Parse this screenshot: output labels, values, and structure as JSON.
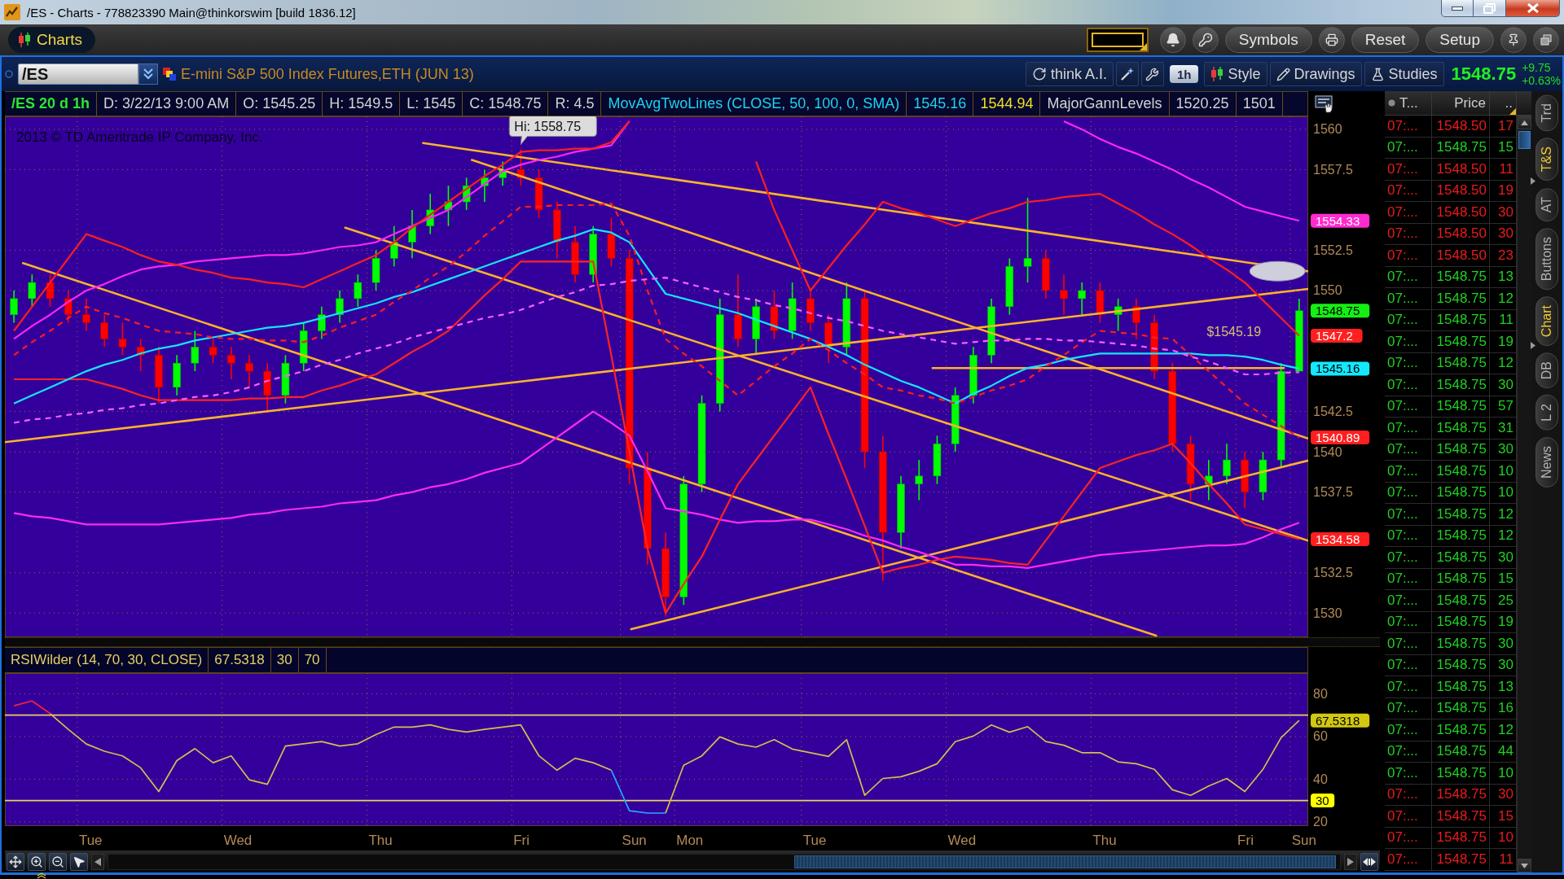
{
  "window": {
    "title": "/ES - Charts - 778823390 Main@thinkorswim [build 1836.12]"
  },
  "toolbar": {
    "tab": {
      "label": "Charts",
      "selected": true
    },
    "buttons": [
      "Symbols",
      "Reset",
      "Setup"
    ]
  },
  "header": {
    "symbol": "/ES",
    "description": "E-mini S&P 500 Index Futures,ETH (JUN 13)",
    "ai_button": "think A.I.",
    "aggregation": "1h",
    "style_button": "Style",
    "drawings_button": "Drawings",
    "studies_button": "Studies",
    "last_price": "1548.75",
    "change": "+9.75",
    "change_percent": "+0.63%"
  },
  "info_row": {
    "symbol": "/ES 20 d 1h",
    "cells": [
      {
        "text": "D: 3/22/13 9:00 AM",
        "color": "#d2d2d2"
      },
      {
        "text": "O: 1545.25",
        "color": "#d2d2d2"
      },
      {
        "text": "H: 1549.5",
        "color": "#d2d2d2"
      },
      {
        "text": "L: 1545",
        "color": "#d2d2d2"
      },
      {
        "text": "C: 1548.75",
        "color": "#d2d2d2"
      },
      {
        "text": "R: 4.5",
        "color": "#d2d2d2"
      },
      {
        "text": "MovAvgTwoLines (CLOSE, 50, 100, 0, SMA)",
        "color": "#1ed2f0"
      },
      {
        "text": "1545.16",
        "color": "#1ed2f0"
      },
      {
        "text": "1544.94",
        "color": "#f0e020"
      },
      {
        "text": "MajorGannLevels",
        "color": "#d2d2d2"
      },
      {
        "text": "1520.25",
        "color": "#d2d2d2"
      },
      {
        "text": "1501",
        "color": "#d2d2d2"
      }
    ]
  },
  "price_chart": {
    "copyright": "2013 © TD Ameritrade IP Company, Inc.",
    "level_label": "$1545.19",
    "axis_badges": [
      {
        "text": "1554.33",
        "color": "#ff2bd0"
      },
      {
        "text": "1548.75",
        "color": "#14f014"
      },
      {
        "text": "1547.2",
        "color": "#ff1f1f"
      },
      {
        "text": "1545.16",
        "color": "#14e8ff"
      },
      {
        "text": "1540.89",
        "color": "#ff1f1f"
      },
      {
        "text": "1534.58",
        "color": "#ff1f1f"
      }
    ],
    "chart_data": {
      "type": "candlestick",
      "grid": true,
      "ylim": [
        1528.5,
        1560.8
      ],
      "yticks": [
        1530,
        1537.5,
        1542.5,
        1552.5,
        1560
      ],
      "categories": [
        null,
        null,
        null,
        null,
        null,
        null,
        null,
        null,
        null,
        null,
        null,
        null,
        null,
        null,
        null,
        null,
        null,
        null,
        null,
        null,
        null,
        null,
        null,
        null,
        null,
        null,
        null,
        null,
        null,
        null,
        null,
        null,
        null,
        null,
        null,
        null,
        null,
        null,
        null,
        null,
        null,
        null,
        null,
        null,
        null,
        null,
        null,
        null,
        null,
        null,
        null,
        null,
        null,
        null,
        null,
        null,
        null,
        null,
        null,
        null,
        null,
        null,
        null,
        null,
        null,
        null,
        null,
        null,
        null,
        null,
        null,
        null
      ],
      "ohlc": [
        [
          1548.5,
          1550,
          1548,
          1549.5
        ],
        [
          1549.5,
          1551,
          1549,
          1550.5
        ],
        [
          1550.5,
          1551,
          1549,
          1549.5
        ],
        [
          1549.5,
          1550,
          1548,
          1548.5
        ],
        [
          1548.5,
          1549.5,
          1547.5,
          1548
        ],
        [
          1548,
          1548.5,
          1546.5,
          1547
        ],
        [
          1547,
          1548,
          1546,
          1546.5
        ],
        [
          1546.5,
          1547,
          1545,
          1546
        ],
        [
          1546,
          1546.5,
          1543,
          1544
        ],
        [
          1544,
          1546,
          1543.5,
          1545.5
        ],
        [
          1545.5,
          1547.5,
          1545,
          1546.5
        ],
        [
          1546.5,
          1547,
          1545.5,
          1546
        ],
        [
          1546,
          1546.5,
          1544.5,
          1545.5
        ],
        [
          1545.5,
          1546,
          1544,
          1545
        ],
        [
          1545,
          1545.5,
          1542.5,
          1543.5
        ],
        [
          1543.5,
          1546,
          1543,
          1545.5
        ],
        [
          1545.5,
          1548,
          1545,
          1547.5
        ],
        [
          1547.5,
          1549,
          1547,
          1548.5
        ],
        [
          1548.5,
          1550,
          1548,
          1549.5
        ],
        [
          1549.5,
          1551,
          1549,
          1550.5
        ],
        [
          1550.5,
          1552.5,
          1550,
          1552
        ],
        [
          1552,
          1554,
          1551.5,
          1553
        ],
        [
          1553,
          1555,
          1552,
          1554
        ],
        [
          1554,
          1556,
          1553.5,
          1555
        ],
        [
          1555,
          1556.5,
          1554,
          1555.5
        ],
        [
          1555.5,
          1557,
          1555,
          1556.5
        ],
        [
          1556.5,
          1557.5,
          1555.5,
          1557
        ],
        [
          1557,
          1558,
          1556.5,
          1557.5
        ],
        [
          1557.5,
          1558.75,
          1556.5,
          1557
        ],
        [
          1557,
          1557.5,
          1554.5,
          1555
        ],
        [
          1555,
          1555.5,
          1552,
          1553
        ],
        [
          1553,
          1554,
          1550.5,
          1551
        ],
        [
          1551,
          1554,
          1550.5,
          1553.5
        ],
        [
          1553.5,
          1554.5,
          1551.5,
          1552
        ],
        [
          1552,
          1552.5,
          1538,
          1539
        ],
        [
          1539,
          1540,
          1533,
          1534
        ],
        [
          1534,
          1535,
          1529.8,
          1531
        ],
        [
          1531,
          1538.5,
          1530.5,
          1538
        ],
        [
          1538,
          1543.5,
          1537.5,
          1543
        ],
        [
          1543,
          1549.5,
          1542.5,
          1548.5
        ],
        [
          1548.5,
          1551,
          1546.5,
          1547
        ],
        [
          1547,
          1549.5,
          1546,
          1549
        ],
        [
          1549,
          1550,
          1547,
          1547.5
        ],
        [
          1547.5,
          1550.5,
          1547,
          1549.5
        ],
        [
          1549.5,
          1550,
          1547.5,
          1548
        ],
        [
          1548,
          1548.5,
          1545.5,
          1546.5
        ],
        [
          1546.5,
          1550.5,
          1546,
          1549.5
        ],
        [
          1549.5,
          1550,
          1539,
          1540
        ],
        [
          1540,
          1541,
          1532,
          1535
        ],
        [
          1535,
          1538.5,
          1534,
          1538
        ],
        [
          1538,
          1539.5,
          1537,
          1538.5
        ],
        [
          1538.5,
          1541,
          1538,
          1540.5
        ],
        [
          1540.5,
          1544,
          1540,
          1543.5
        ],
        [
          1543.5,
          1546.5,
          1543,
          1546
        ],
        [
          1546,
          1549.5,
          1545.5,
          1549
        ],
        [
          1549,
          1552,
          1548.5,
          1551.5
        ],
        [
          1551.5,
          1555.75,
          1550.5,
          1552
        ],
        [
          1552,
          1552.5,
          1549.5,
          1550
        ],
        [
          1550,
          1551,
          1548.5,
          1549.5
        ],
        [
          1549.5,
          1550.5,
          1548.5,
          1550
        ],
        [
          1550,
          1550.5,
          1548,
          1548.5
        ],
        [
          1548.5,
          1549.5,
          1547.5,
          1549
        ],
        [
          1549,
          1549.5,
          1547,
          1548
        ],
        [
          1548,
          1548.5,
          1544.5,
          1545
        ],
        [
          1545,
          1545.5,
          1540,
          1540.5
        ],
        [
          1540.5,
          1541,
          1537,
          1538
        ],
        [
          1538,
          1539.5,
          1537,
          1538.5
        ],
        [
          1538.5,
          1540.5,
          1538,
          1539.5
        ],
        [
          1539.5,
          1540,
          1536.5,
          1537.5
        ],
        [
          1537.5,
          1540,
          1537,
          1539.5
        ],
        [
          1539.5,
          1545.5,
          1539,
          1545
        ],
        [
          1545,
          1549.5,
          1545,
          1548.75
        ]
      ],
      "annotations": [
        "Hi: 1558.75"
      ]
    },
    "studies": {
      "chart_data": {
        "type": "line",
        "grid": true,
        "ylim": [
          1528.5,
          1560.8
        ],
        "yticks": [
          1532.5,
          1540,
          1550,
          1557.5
        ],
        "categories": [
          null,
          null,
          null,
          null,
          null,
          null,
          null,
          null,
          null,
          null,
          null,
          null,
          null,
          null,
          null,
          null,
          null,
          null,
          null,
          null,
          null,
          null,
          null,
          null,
          null,
          null,
          null,
          null,
          null,
          null,
          null,
          null,
          null,
          null,
          null,
          null,
          null,
          null,
          null,
          null,
          null,
          null,
          null,
          null,
          null,
          null,
          null,
          null,
          null,
          null,
          null,
          null,
          null,
          null,
          null,
          null,
          null,
          null,
          null,
          null,
          null,
          null,
          null,
          null,
          null,
          null,
          null,
          null,
          null,
          null,
          null,
          null
        ],
        "series": [
          {
            "color": "#ff26f0",
            "values": [
              1547,
              1547.8,
              1548.5,
              1549.3,
              1550,
              1550.4,
              1550.9,
              1551.3,
              1551.5,
              1551.6,
              1551.8,
              1551.9,
              1552,
              1552.1,
              1552.2,
              1552.2,
              1552.3,
              1552.5,
              1552.7,
              1552.8,
              1553,
              1553.5,
              1554,
              1554.5,
              1555,
              1555.8,
              1556.6,
              1557.4,
              1557.8,
              1558.1,
              1558.3,
              1558.6,
              1558.8,
              1559,
              1560.5,
              null,
              null,
              null,
              null,
              null,
              null,
              null,
              null,
              null,
              null,
              null,
              null,
              null,
              null,
              null,
              null,
              null,
              null,
              null,
              null,
              null,
              null,
              null,
              1560.5,
              1560,
              1559.4,
              1558.9,
              1558.5,
              1558,
              1557.5,
              1556.9,
              1556.4,
              1555.8,
              1555.2,
              1554.9,
              1554.6,
              1554.33
            ]
          },
          {
            "color": "#ff2aee",
            "values": [
              1536.2,
              1536,
              1535.9,
              1535.7,
              1535.5,
              1535.5,
              1535.5,
              1535.5,
              1535.5,
              1535.6,
              1535.7,
              1535.8,
              1535.9,
              1536.1,
              1536.2,
              1536.4,
              1536.5,
              1536.6,
              1536.8,
              1536.9,
              1537,
              1537.3,
              1537.5,
              1537.8,
              1538,
              1538.3,
              1538.7,
              1539,
              1539.3,
              1540.1,
              1540.9,
              1541.7,
              1542.5,
              1541.8,
              1541,
              1538.8,
              1536.5,
              1536.3,
              1536.1,
              1535.8,
              1535.6,
              1535.7,
              1535.7,
              1535.8,
              1535.8,
              1535.5,
              1535.2,
              1534.8,
              1534.5,
              1534.1,
              1533.8,
              1533.4,
              1533,
              1533,
              1532.9,
              1532.9,
              1532.8,
              1533,
              1533.2,
              1533.4,
              1533.6,
              1533.7,
              1533.8,
              1533.9,
              1534,
              1534.1,
              1534.2,
              1534.2,
              1534.3,
              1534.7,
              1535.2,
              1535.6
            ]
          },
          {
            "color": "#ff1e1e",
            "values": [
              1547.5,
              1549,
              1550.5,
              1552,
              1553.5,
              1553.1,
              1552.7,
              1552.2,
              1551.8,
              1551.6,
              1551.3,
              1551.1,
              1550.8,
              1550.7,
              1550.5,
              1550.4,
              1550.2,
              1550.7,
              1551.2,
              1551.7,
              1552.2,
              1553,
              1553.9,
              1554.7,
              1555.5,
              1556.3,
              1557.1,
              1557.8,
              1558.6,
              1558.7,
              1558.7,
              1558.8,
              1558.8,
              1559.2,
              1560.5,
              null,
              null,
              null,
              null,
              null,
              null,
              1558,
              1555,
              1552.5,
              1550,
              1551.4,
              1552.8,
              1554.1,
              1555.5,
              1555.1,
              1554.8,
              1554.4,
              1554,
              1554.4,
              1554.8,
              1555.1,
              1555.5,
              1555.6,
              1555.8,
              1555.9,
              1556,
              1555.4,
              1554.8,
              1554.1,
              1553.5,
              1552.8,
              1552,
              1551.3,
              1550.5,
              1549.4,
              1548.3,
              1547.2
            ]
          },
          {
            "color": "#ff2222",
            "values": [
              1544.5,
              1544.5,
              1544.5,
              1544.5,
              1544.5,
              1544.2,
              1543.9,
              1543.5,
              1543.2,
              1543.2,
              1543.2,
              1543.2,
              1543.2,
              1543.3,
              1543.3,
              1543.4,
              1543.4,
              1543.8,
              1544.1,
              1544.5,
              1544.8,
              1545.5,
              1546.2,
              1546.8,
              1547.5,
              1548.6,
              1549.7,
              1550.7,
              1551.8,
              1551.8,
              1551.8,
              1551.8,
              1551.8,
              1546,
              1540,
              1534,
              1530,
              1531.8,
              1533.5,
              1535.8,
              1538,
              1539.5,
              1541,
              1542.5,
              1544,
              1541.1,
              1538.3,
              1535.4,
              1532.5,
              1532.8,
              1533,
              1533.3,
              1533.5,
              1533.4,
              1533.3,
              1533.1,
              1533,
              1534.5,
              1536,
              1537.5,
              1539,
              1539.4,
              1539.8,
              1540.1,
              1540.5,
              1539.3,
              1538,
              1536.8,
              1535.5,
              1535.2,
              1534.9,
              1534.58
            ]
          },
          {
            "color": "#16e4ff",
            "values": [
              1543,
              1543.5,
              1544,
              1544.5,
              1545,
              1545.4,
              1545.7,
              1546.1,
              1546.4,
              1546.6,
              1546.9,
              1547.1,
              1547.3,
              1547.5,
              1547.7,
              1547.8,
              1548,
              1548.3,
              1548.6,
              1548.9,
              1549.2,
              1549.6,
              1549.9,
              1550.3,
              1550.7,
              1551.1,
              1551.5,
              1551.9,
              1552.3,
              1552.7,
              1553.1,
              1553.4,
              1553.8,
              1553.6,
              1553,
              1551.4,
              1549.8,
              1549.5,
              1549.2,
              1548.9,
              1548.6,
              1548.2,
              1547.8,
              1547.4,
              1547,
              1546.5,
              1546,
              1545.4,
              1544.9,
              1544.4,
              1544,
              1543.5,
              1543,
              1543.6,
              1544.1,
              1544.7,
              1545.2,
              1545.4,
              1545.7,
              1545.9,
              1546.1,
              1546.1,
              1546.1,
              1546.1,
              1546.1,
              1546.1,
              1546,
              1546,
              1545.9,
              1545.7,
              1545.4,
              1545.16
            ]
          },
          {
            "color": "#ff1c1c",
            "line_style": "dashed",
            "values": [
              1546,
              1546.8,
              1547.5,
              1548.3,
              1549,
              1548.6,
              1548.3,
              1547.9,
              1547.5,
              1547.4,
              1547.3,
              1547.1,
              1547,
              1547,
              1546.9,
              1546.9,
              1546.8,
              1547.2,
              1547.7,
              1548.1,
              1548.5,
              1549.3,
              1550,
              1550.8,
              1551.5,
              1552.4,
              1553.4,
              1554.3,
              1555.2,
              1555.2,
              1555.3,
              1555.3,
              1555.3,
              1555.4,
              1553.4,
              1550,
              1547,
              1546.1,
              1545.3,
              1544.4,
              1543.5,
              1544.4,
              1545.3,
              1546.1,
              1547,
              1546.3,
              1545.5,
              1544.8,
              1544,
              1543.8,
              1543.5,
              1543.3,
              1543,
              1543.4,
              1543.8,
              1544.1,
              1544.5,
              1545.3,
              1546,
              1546.8,
              1547.5,
              1547.4,
              1547.3,
              1547.1,
              1547,
              1546,
              1545,
              1544,
              1543,
              1542.3,
              1541.6,
              1540.89
            ]
          },
          {
            "color": "#ff5cff",
            "line_style": "dashed",
            "values": [
              1541.8,
              1542,
              1542.1,
              1542.3,
              1542.4,
              1542.6,
              1542.7,
              1542.9,
              1543,
              1543.2,
              1543.4,
              1543.5,
              1543.7,
              1544,
              1544.4,
              1544.7,
              1545,
              1545.4,
              1545.7,
              1546.1,
              1546.4,
              1546.7,
              1547.1,
              1547.4,
              1547.7,
              1548,
              1548.3,
              1548.5,
              1548.8,
              1549.2,
              1549.6,
              1549.9,
              1550.3,
              1550.4,
              1550.6,
              1550.7,
              1550.8,
              1550.5,
              1550.2,
              1549.9,
              1549.6,
              1549.4,
              1549.1,
              1548.9,
              1548.6,
              1548.3,
              1548.1,
              1547.8,
              1547.5,
              1547.3,
              1547.1,
              1546.9,
              1546.7,
              1546.8,
              1546.9,
              1546.9,
              1547,
              1547,
              1546.9,
              1546.9,
              1546.8,
              1546.7,
              1546.6,
              1546.4,
              1546.3,
              1545.9,
              1545.6,
              1545.2,
              1544.8,
              1544.8,
              1544.9,
              1544.94
            ]
          }
        ]
      }
    }
  },
  "rsi": {
    "header": [
      "RSIWilder (14, 70, 30, CLOSE)",
      "67.5318",
      "30",
      "70"
    ],
    "axis_badges": [
      {
        "text": "67.5318",
        "color": "#d2c810"
      },
      {
        "text": "30",
        "color": "#ffff00"
      }
    ],
    "chart_data": {
      "type": "line",
      "grid": true,
      "ylim": [
        18,
        89.7
      ],
      "yticks": [
        20,
        40,
        60,
        80
      ],
      "categories": [
        null,
        null,
        null,
        null,
        "Tue",
        null,
        null,
        null,
        null,
        null,
        null,
        null,
        "Wed",
        null,
        null,
        null,
        null,
        null,
        null,
        null,
        "Thu",
        null,
        null,
        null,
        null,
        null,
        null,
        null,
        "Fri",
        null,
        null,
        null,
        null,
        null,
        "Sun",
        null,
        null,
        "Mon",
        null,
        null,
        null,
        null,
        null,
        null,
        "Tue",
        null,
        null,
        null,
        null,
        null,
        null,
        null,
        "Wed",
        null,
        null,
        null,
        null,
        null,
        null,
        null,
        "Thu",
        null,
        null,
        null,
        null,
        null,
        null,
        null,
        "Fri",
        null,
        null,
        "Sun"
      ],
      "series": [
        {
          "color": "#d9bd4c",
          "values": [
            null,
            null,
            70.7,
            63.3,
            56.5,
            53.1,
            50.9,
            45.3,
            34.2,
            48.7,
            54.3,
            47.7,
            50.9,
            39.7,
            37.6,
            55.5,
            56.6,
            57.6,
            55.5,
            56.6,
            60.9,
            64.4,
            64.4,
            65.4,
            63.3,
            62.1,
            63.3,
            64.4,
            65.4,
            50.9,
            44.2,
            49.8,
            47.7,
            44.2,
            null,
            null,
            24.1,
            46.5,
            50.9,
            59.8,
            56.5,
            55,
            58.5,
            54.1,
            52.4,
            50.7,
            58.5,
            32.4,
            40.3,
            41.1,
            43.7,
            47.2,
            57.6,
            60.2,
            65.4,
            62,
            64.6,
            57.6,
            55.9,
            52.4,
            52.4,
            48.1,
            47.2,
            44.6,
            35,
            32.4,
            36.8,
            40.3,
            34.2,
            44.6,
            59.4,
            67.5
          ]
        },
        {
          "color": "#ff1e3c",
          "values": [
            74.4,
            76.6,
            70.7,
            null,
            null,
            null,
            null,
            null,
            null,
            null,
            null,
            null,
            null,
            null,
            null,
            null,
            null,
            null,
            null,
            null,
            null,
            null,
            null,
            null,
            null,
            null,
            null,
            null,
            null,
            null,
            null,
            null,
            null,
            null,
            null,
            null,
            null,
            null,
            null,
            null,
            null,
            null,
            null,
            null,
            null,
            null,
            null,
            null,
            null,
            null,
            null,
            null,
            null,
            null,
            null,
            null,
            null,
            null,
            null,
            null,
            null,
            null,
            null,
            null,
            null,
            null,
            null,
            null,
            null,
            null,
            null,
            null
          ]
        },
        {
          "color": "#27a8ff",
          "values": [
            null,
            null,
            null,
            null,
            null,
            null,
            null,
            null,
            null,
            null,
            null,
            null,
            null,
            null,
            null,
            null,
            null,
            null,
            null,
            null,
            null,
            null,
            null,
            null,
            null,
            null,
            null,
            null,
            null,
            null,
            null,
            null,
            null,
            44.2,
            25.2,
            24.1,
            24.1,
            null,
            null,
            null,
            null,
            null,
            null,
            null,
            null,
            null,
            null,
            null,
            null,
            null,
            null,
            null,
            null,
            null,
            null,
            null,
            null,
            null,
            null,
            null,
            null,
            null,
            null,
            null,
            null,
            null,
            null,
            null,
            null,
            null,
            null,
            null
          ]
        }
      ],
      "ref_lines": [
        {
          "axis": "y",
          "value": 70
        },
        {
          "axis": "y",
          "value": 30
        }
      ]
    }
  },
  "time_and_sales": {
    "columns": [
      "T...",
      "Price",
      ".."
    ],
    "rows": [
      {
        "time": "07:...",
        "price": "1548.50",
        "size": "17",
        "color": "#e81c1c"
      },
      {
        "time": "07:...",
        "price": "1548.75",
        "size": "15",
        "color": "#1fd21f"
      },
      {
        "time": "07:...",
        "price": "1548.50",
        "size": "11",
        "color": "#e81c1c"
      },
      {
        "time": "07:...",
        "price": "1548.50",
        "size": "19",
        "color": "#e81c1c"
      },
      {
        "time": "07:...",
        "price": "1548.50",
        "size": "30",
        "color": "#e81c1c"
      },
      {
        "time": "07:...",
        "price": "1548.50",
        "size": "30",
        "color": "#e81c1c"
      },
      {
        "time": "07:...",
        "price": "1548.50",
        "size": "23",
        "color": "#e81c1c"
      },
      {
        "time": "07:...",
        "price": "1548.75",
        "size": "13",
        "color": "#1fd21f"
      },
      {
        "time": "07:...",
        "price": "1548.75",
        "size": "12",
        "color": "#1fd21f"
      },
      {
        "time": "07:...",
        "price": "1548.75",
        "size": "11",
        "color": "#1fd21f"
      },
      {
        "time": "07:...",
        "price": "1548.75",
        "size": "19",
        "color": "#1fd21f"
      },
      {
        "time": "07:...",
        "price": "1548.75",
        "size": "12",
        "color": "#1fd21f"
      },
      {
        "time": "07:...",
        "price": "1548.75",
        "size": "30",
        "color": "#1fd21f"
      },
      {
        "time": "07:...",
        "price": "1548.75",
        "size": "57",
        "color": "#1fd21f"
      },
      {
        "time": "07:...",
        "price": "1548.75",
        "size": "31",
        "color": "#1fd21f"
      },
      {
        "time": "07:...",
        "price": "1548.75",
        "size": "30",
        "color": "#1fd21f"
      },
      {
        "time": "07:...",
        "price": "1548.75",
        "size": "10",
        "color": "#1fd21f"
      },
      {
        "time": "07:...",
        "price": "1548.75",
        "size": "10",
        "color": "#1fd21f"
      },
      {
        "time": "07:...",
        "price": "1548.75",
        "size": "12",
        "color": "#1fd21f"
      },
      {
        "time": "07:...",
        "price": "1548.75",
        "size": "12",
        "color": "#1fd21f"
      },
      {
        "time": "07:...",
        "price": "1548.75",
        "size": "30",
        "color": "#1fd21f"
      },
      {
        "time": "07:...",
        "price": "1548.75",
        "size": "15",
        "color": "#1fd21f"
      },
      {
        "time": "07:...",
        "price": "1548.75",
        "size": "25",
        "color": "#1fd21f"
      },
      {
        "time": "07:...",
        "price": "1548.75",
        "size": "19",
        "color": "#1fd21f"
      },
      {
        "time": "07:...",
        "price": "1548.75",
        "size": "30",
        "color": "#1fd21f"
      },
      {
        "time": "07:...",
        "price": "1548.75",
        "size": "30",
        "color": "#1fd21f"
      },
      {
        "time": "07:...",
        "price": "1548.75",
        "size": "13",
        "color": "#1fd21f"
      },
      {
        "time": "07:...",
        "price": "1548.75",
        "size": "16",
        "color": "#1fd21f"
      },
      {
        "time": "07:...",
        "price": "1548.75",
        "size": "12",
        "color": "#1fd21f"
      },
      {
        "time": "07:...",
        "price": "1548.75",
        "size": "44",
        "color": "#1fd21f"
      },
      {
        "time": "07:...",
        "price": "1548.75",
        "size": "10",
        "color": "#1fd21f"
      },
      {
        "time": "07:...",
        "price": "1548.75",
        "size": "30",
        "color": "#e81c1c"
      },
      {
        "time": "07:...",
        "price": "1548.75",
        "size": "15",
        "color": "#e81c1c"
      },
      {
        "time": "07:...",
        "price": "1548.75",
        "size": "10",
        "color": "#e81c1c"
      },
      {
        "time": "07:...",
        "price": "1548.75",
        "size": "11",
        "color": "#e81c1c"
      }
    ]
  },
  "side_tabs": [
    {
      "label": "Trd",
      "selected": false
    },
    {
      "label": "T&S",
      "selected": true
    },
    {
      "label": "AT",
      "selected": false
    },
    {
      "label": "Buttons",
      "selected": false
    },
    {
      "label": "Chart",
      "selected": true
    },
    {
      "label": "DB",
      "selected": false
    },
    {
      "label": "L 2",
      "selected": false
    },
    {
      "label": "News",
      "selected": false
    }
  ]
}
